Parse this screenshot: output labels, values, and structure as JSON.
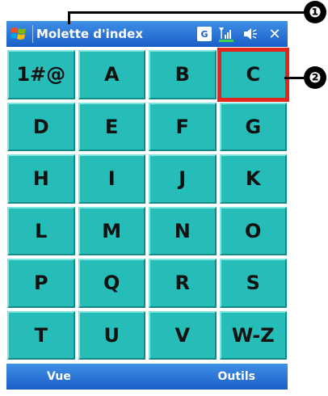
{
  "titlebar": {
    "app_title": "Molette d'index",
    "badge": "G",
    "icons": [
      "windows-start-icon",
      "signal-icon",
      "speaker-icon",
      "close-icon"
    ],
    "close_label": "✕"
  },
  "grid": {
    "cells": [
      "1#@",
      "A",
      "B",
      "C",
      "D",
      "E",
      "F",
      "G",
      "H",
      "I",
      "J",
      "K",
      "L",
      "M",
      "N",
      "O",
      "P",
      "Q",
      "R",
      "S",
      "T",
      "U",
      "V",
      "W-Z"
    ],
    "selected": "C"
  },
  "menubar": {
    "left": "Vue",
    "right": "Outils"
  },
  "callouts": [
    "❶",
    "❷"
  ],
  "colors": {
    "titlebar": "#1b5fc7",
    "cell": "#26bdb8",
    "highlight": "#e2261d"
  }
}
